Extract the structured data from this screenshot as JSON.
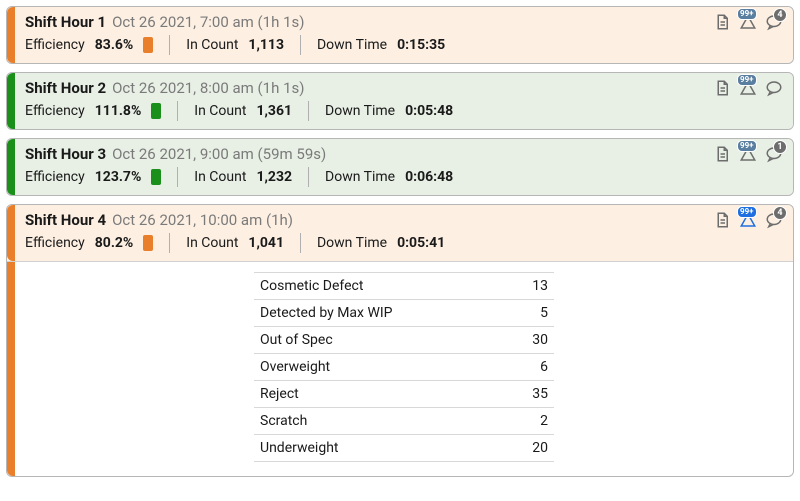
{
  "labels": {
    "efficiency": "Efficiency",
    "in_count": "In Count",
    "down_time": "Down Time",
    "badge_99": "99+"
  },
  "colors": {
    "orange": "#e97f2b",
    "green": "#1a8f1a",
    "bg_orange": "#fdf0e3",
    "bg_green": "#e8f0e5"
  },
  "hours": [
    {
      "title": "Shift Hour 1",
      "subtitle": "Oct 26 2021, 7:00 am (1h 1s)",
      "efficiency": "83.6%",
      "in_count": "1,113",
      "down_time": "0:15:35",
      "status": "orange",
      "chat_count": "4",
      "expanded": false
    },
    {
      "title": "Shift Hour 2",
      "subtitle": "Oct 26 2021, 8:00 am (1h 1s)",
      "efficiency": "111.8%",
      "in_count": "1,361",
      "down_time": "0:05:48",
      "status": "green",
      "chat_count": null,
      "expanded": false
    },
    {
      "title": "Shift Hour 3",
      "subtitle": "Oct 26 2021, 9:00 am (59m 59s)",
      "efficiency": "123.7%",
      "in_count": "1,232",
      "down_time": "0:06:48",
      "status": "green",
      "chat_count": "1",
      "expanded": false
    },
    {
      "title": "Shift Hour 4",
      "subtitle": "Oct 26 2021, 10:00 am (1h)",
      "efficiency": "80.2%",
      "in_count": "1,041",
      "down_time": "0:05:41",
      "status": "orange",
      "chat_count": "4",
      "expanded": true,
      "active": true
    }
  ],
  "detail": [
    {
      "k": "Cosmetic Defect",
      "v": "13"
    },
    {
      "k": "Detected by Max WIP",
      "v": "5"
    },
    {
      "k": "Out of Spec",
      "v": "30"
    },
    {
      "k": "Overweight",
      "v": "6"
    },
    {
      "k": "Reject",
      "v": "35"
    },
    {
      "k": "Scratch",
      "v": "2"
    },
    {
      "k": "Underweight",
      "v": "20"
    }
  ]
}
